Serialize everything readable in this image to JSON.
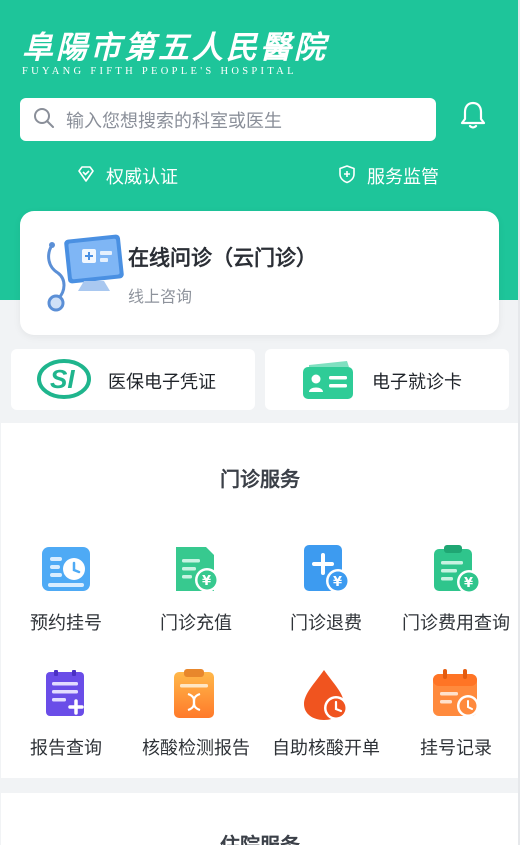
{
  "header": {
    "hospital_name": "阜陽市第五人民醫院",
    "hospital_name_en": "FUYANG FIFTH PEOPLE'S HOSPITAL",
    "brand_color": "#1ec59a"
  },
  "search": {
    "placeholder": "输入您想搜索的科室或医生"
  },
  "badges": {
    "auth": "权威认证",
    "supervision": "服务监管"
  },
  "consult": {
    "title": "在线问诊（云门诊）",
    "subtitle": "线上咨询"
  },
  "quick_cards": {
    "insurance": "医保电子凭证",
    "ecard": "电子就诊卡"
  },
  "outpatient": {
    "title": "门诊服务",
    "items": [
      {
        "label": "预约挂号",
        "icon": "calendar-clock-icon"
      },
      {
        "label": "门诊充值",
        "icon": "document-yuan-icon"
      },
      {
        "label": "门诊退费",
        "icon": "plus-yuan-icon"
      },
      {
        "label": "门诊费用查询",
        "icon": "clipboard-yuan-icon"
      },
      {
        "label": "报告查询",
        "icon": "report-plus-icon"
      },
      {
        "label": "核酸检测报告",
        "icon": "clipboard-dna-icon"
      },
      {
        "label": "自助核酸开单",
        "icon": "drop-clock-icon"
      },
      {
        "label": "挂号记录",
        "icon": "calendar-clock-icon"
      }
    ]
  },
  "inpatient": {
    "title": "住院服务"
  }
}
